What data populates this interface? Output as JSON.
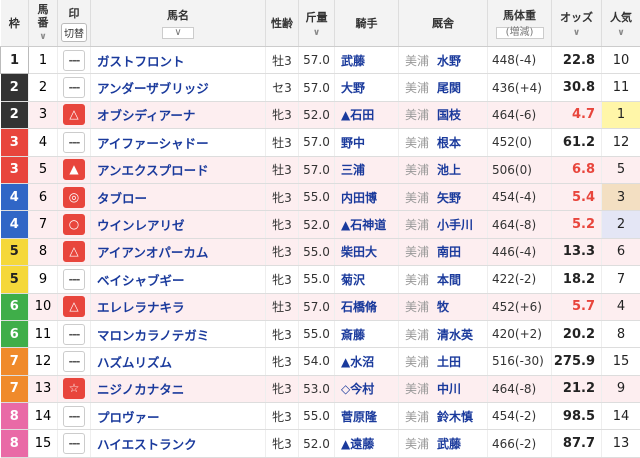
{
  "header": {
    "waku": "枠",
    "umaban": "馬番",
    "mark": "印",
    "mark_toggle": "切替",
    "name": "馬名",
    "sexage": "性齢",
    "kinryo": "斤量",
    "jockey": "騎手",
    "stable": "厩舎",
    "weight": "馬体重",
    "weight_sub": "(増減)",
    "odds": "オッズ",
    "popularity": "人気",
    "sort_icon": "chevron-down-icon"
  },
  "rows": [
    {
      "waku": "1",
      "umaban": "1",
      "mark": "---",
      "mark_type": "dash",
      "name": "ガストフロント",
      "sexage": "牡3",
      "kinryo": "57.0",
      "jockey": "武藤",
      "region": "美浦",
      "trainer": "水野",
      "weight": "448(-4)",
      "odds": "22.8",
      "popularity": "10",
      "highlight": false
    },
    {
      "waku": "2",
      "umaban": "2",
      "mark": "---",
      "mark_type": "dash",
      "name": "アンダーザブリッジ",
      "sexage": "セ3",
      "kinryo": "57.0",
      "jockey": "大野",
      "region": "美浦",
      "trainer": "尾関",
      "weight": "436(+4)",
      "odds": "30.8",
      "popularity": "11",
      "highlight": false
    },
    {
      "waku": "2",
      "umaban": "3",
      "mark": "△",
      "mark_type": "red-triangle-outline",
      "name": "オブシディアーナ",
      "sexage": "牝3",
      "kinryo": "52.0",
      "jockey": "▲石田",
      "region": "美浦",
      "trainer": "国枝",
      "weight": "464(-6)",
      "odds": "4.7",
      "popularity": "1",
      "highlight": true
    },
    {
      "waku": "3",
      "umaban": "4",
      "mark": "---",
      "mark_type": "dash",
      "name": "アイファーシャドー",
      "sexage": "牡3",
      "kinryo": "57.0",
      "jockey": "野中",
      "region": "美浦",
      "trainer": "根本",
      "weight": "452(0)",
      "odds": "61.2",
      "popularity": "12",
      "highlight": false
    },
    {
      "waku": "3",
      "umaban": "5",
      "mark": "▲",
      "mark_type": "red-triangle-filled",
      "name": "アンエクスプロード",
      "sexage": "牡3",
      "kinryo": "57.0",
      "jockey": "三浦",
      "region": "美浦",
      "trainer": "池上",
      "weight": "506(0)",
      "odds": "6.8",
      "popularity": "5",
      "highlight": true
    },
    {
      "waku": "4",
      "umaban": "6",
      "mark": "◎",
      "mark_type": "red-double-circle",
      "name": "タブロー",
      "sexage": "牝3",
      "kinryo": "55.0",
      "jockey": "内田博",
      "region": "美浦",
      "trainer": "矢野",
      "weight": "454(-4)",
      "odds": "5.4",
      "popularity": "3",
      "highlight": true
    },
    {
      "waku": "4",
      "umaban": "7",
      "mark": "○",
      "mark_type": "red-circle",
      "name": "ウインレアリゼ",
      "sexage": "牝3",
      "kinryo": "52.0",
      "jockey": "▲石神道",
      "region": "美浦",
      "trainer": "小手川",
      "weight": "464(-8)",
      "odds": "5.2",
      "popularity": "2",
      "highlight": true
    },
    {
      "waku": "5",
      "umaban": "8",
      "mark": "△",
      "mark_type": "red-triangle-outline",
      "name": "アイアンオパーカム",
      "sexage": "牝3",
      "kinryo": "55.0",
      "jockey": "柴田大",
      "region": "美浦",
      "trainer": "南田",
      "weight": "446(-4)",
      "odds": "13.3",
      "popularity": "6",
      "highlight": true
    },
    {
      "waku": "5",
      "umaban": "9",
      "mark": "---",
      "mark_type": "dash",
      "name": "ベイシャブギー",
      "sexage": "牝3",
      "kinryo": "55.0",
      "jockey": "菊沢",
      "region": "美浦",
      "trainer": "本間",
      "weight": "422(-2)",
      "odds": "18.2",
      "popularity": "7",
      "highlight": false
    },
    {
      "waku": "6",
      "umaban": "10",
      "mark": "△",
      "mark_type": "red-triangle-outline",
      "name": "エレレラナキラ",
      "sexage": "牡3",
      "kinryo": "57.0",
      "jockey": "石橋脩",
      "region": "美浦",
      "trainer": "牧",
      "weight": "452(+6)",
      "odds": "5.7",
      "popularity": "4",
      "highlight": true
    },
    {
      "waku": "6",
      "umaban": "11",
      "mark": "---",
      "mark_type": "dash",
      "name": "マロンカラノテガミ",
      "sexage": "牝3",
      "kinryo": "55.0",
      "jockey": "斎藤",
      "region": "美浦",
      "trainer": "清水英",
      "weight": "420(+2)",
      "odds": "20.2",
      "popularity": "8",
      "highlight": false
    },
    {
      "waku": "7",
      "umaban": "12",
      "mark": "---",
      "mark_type": "dash",
      "name": "ハズムリズム",
      "sexage": "牝3",
      "kinryo": "54.0",
      "jockey": "▲水沼",
      "region": "美浦",
      "trainer": "土田",
      "weight": "516(-30)",
      "odds": "275.9",
      "popularity": "15",
      "highlight": false
    },
    {
      "waku": "7",
      "umaban": "13",
      "mark": "☆",
      "mark_type": "red-star",
      "name": "ニジノカナタニ",
      "sexage": "牝3",
      "kinryo": "53.0",
      "jockey": "◇今村",
      "region": "美浦",
      "trainer": "中川",
      "weight": "464(-8)",
      "odds": "21.2",
      "popularity": "9",
      "highlight": true
    },
    {
      "waku": "8",
      "umaban": "14",
      "mark": "---",
      "mark_type": "dash",
      "name": "プロヴァー",
      "sexage": "牝3",
      "kinryo": "55.0",
      "jockey": "菅原隆",
      "region": "美浦",
      "trainer": "鈴木慎",
      "weight": "454(-2)",
      "odds": "98.5",
      "popularity": "14",
      "highlight": false
    },
    {
      "waku": "8",
      "umaban": "15",
      "mark": "---",
      "mark_type": "dash",
      "name": "ハイエストランク",
      "sexage": "牝3",
      "kinryo": "52.0",
      "jockey": "▲遠藤",
      "region": "美浦",
      "trainer": "武藤",
      "weight": "466(-2)",
      "odds": "87.7",
      "popularity": "13",
      "highlight": false
    }
  ]
}
